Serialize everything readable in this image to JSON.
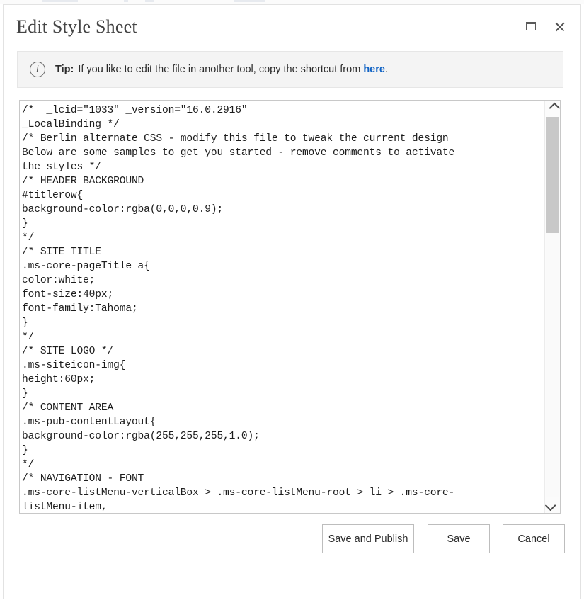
{
  "window": {
    "title": "Edit Style Sheet",
    "maximize_icon": "maximize-icon",
    "close_icon": "close-icon"
  },
  "tip": {
    "info_icon": "info-icon",
    "glyph": "i",
    "label": "Tip:",
    "text_before": "If you like to edit the file in another tool, copy the shortcut from",
    "link_text": "here",
    "text_after": ".",
    "link_color": "#0f62c4"
  },
  "editor": {
    "content": "/*  _lcid=\"1033\" _version=\"16.0.2916\"\n_LocalBinding */\n/* Berlin alternate CSS - modify this file to tweak the current design\nBelow are some samples to get you started - remove comments to activate\nthe styles */\n/* HEADER BACKGROUND\n#titlerow{\nbackground-color:rgba(0,0,0,0.9);\n}\n*/\n/* SITE TITLE\n.ms-core-pageTitle a{\ncolor:white;\nfont-size:40px;\nfont-family:Tahoma;\n}\n*/\n/* SITE LOGO */\n.ms-siteicon-img{\nheight:60px;\n}\n/* CONTENT AREA\n.ms-pub-contentLayout{\nbackground-color:rgba(255,255,255,1.0);\n}\n*/\n/* NAVIGATION - FONT\n.ms-core-listMenu-verticalBox > .ms-core-listMenu-root > li > .ms-core-\nlistMenu-item,\n.ms-core-listMenu-verticalBox > .ms-core-listMenu-root > li > .ms-core-",
    "scrollbar": {
      "up_arrow_icon": "chevron-up-icon",
      "down_arrow_icon": "chevron-down-icon",
      "thumb_name": "scrollbar-thumb"
    }
  },
  "footer": {
    "save_and_publish_label": "Save and Publish",
    "save_label": "Save",
    "cancel_label": "Cancel"
  }
}
